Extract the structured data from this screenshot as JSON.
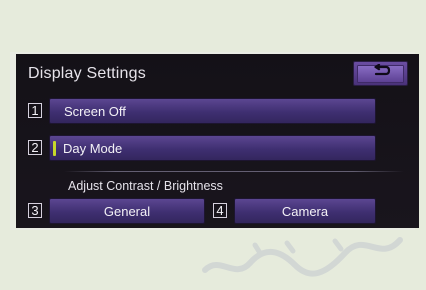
{
  "display": {
    "title": "Display Settings",
    "back_icon": "return-arrow-icon",
    "buttons": [
      {
        "number": "1",
        "label": "Screen Off"
      },
      {
        "number": "2",
        "label": "Day Mode",
        "indicator_color": "#c7d92a"
      }
    ],
    "subtitle": "Adjust Contrast / Brightness",
    "adjust_buttons": [
      {
        "number": "3",
        "label": "General"
      },
      {
        "number": "4",
        "label": "Camera"
      }
    ]
  },
  "colors": {
    "background": "#e6ebdc",
    "screen_bg": "#141117",
    "button_purple": "#4a3279",
    "indicator": "#c7d92a"
  },
  "watermark": {
    "icon": "watermark-script-icon"
  }
}
